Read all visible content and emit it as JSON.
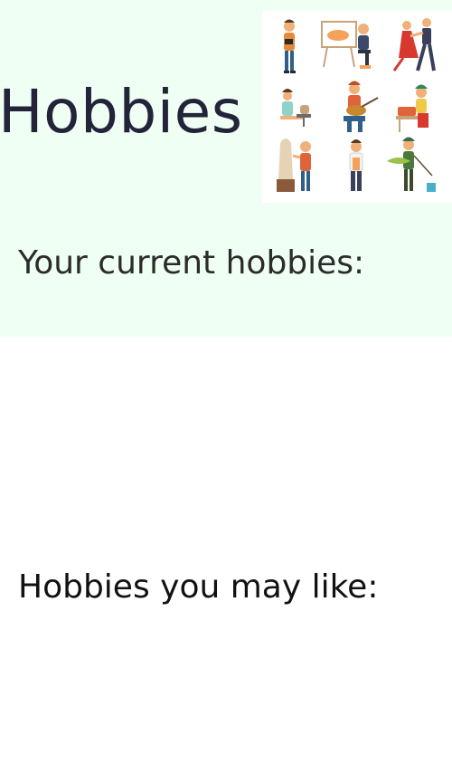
{
  "page": {
    "title": "Hobbies",
    "current_section_label": "Your current hobbies:",
    "suggest_section_label": "Hobbies you may like:"
  },
  "colors": {
    "top_background": "#effff4",
    "page_background": "#ffffff",
    "title_text": "#23243a"
  },
  "illustration": {
    "icon": "hobby-people-illustration"
  },
  "current_hobbies": [],
  "suggested_hobbies": []
}
